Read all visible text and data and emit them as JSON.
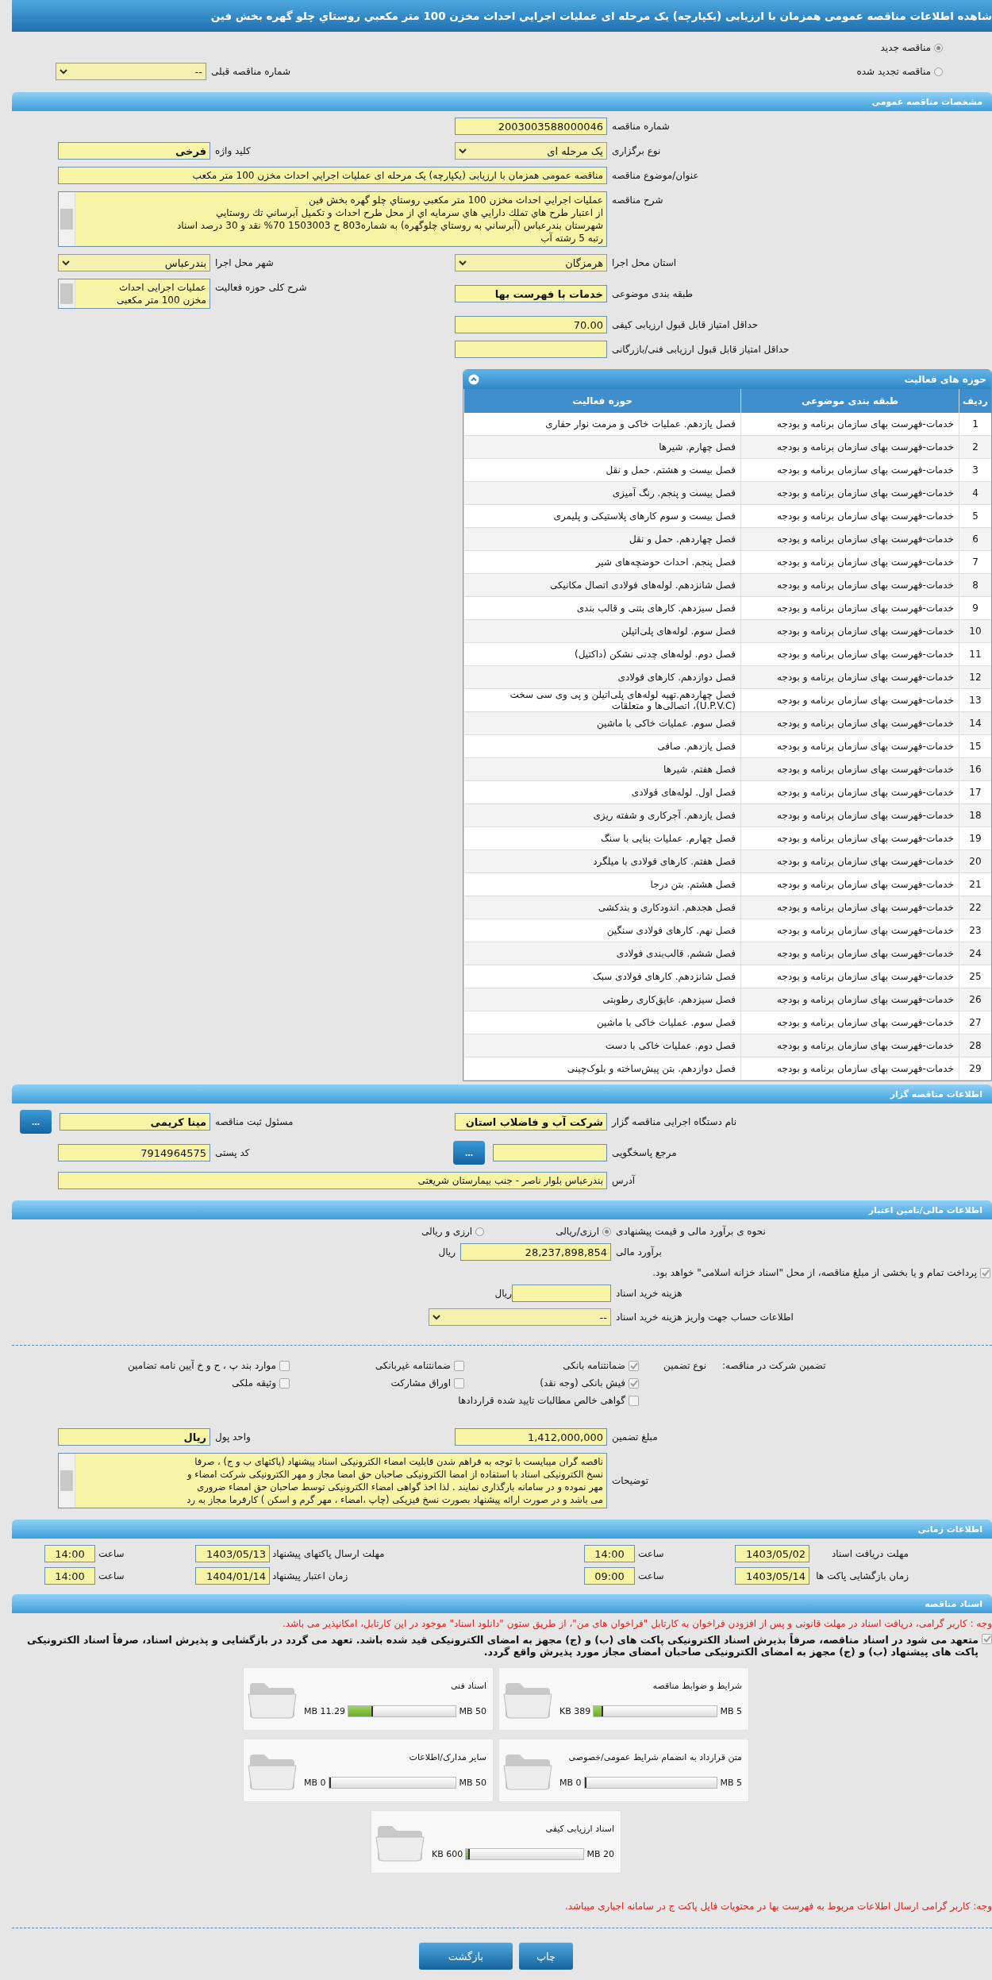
{
  "title": "شاهده اطلاعات مناقصه عمومی همزمان با ارزیابی (یکپارچه) یک مرحله ای عملیات اجرايي احداث مخزن 100 متر مكعبي روستاي چلو گهره بخش فين",
  "tender_type": [
    {
      "label": "مناقصه جدید",
      "selected": true
    },
    {
      "label": "مناقصه تجدید شده",
      "selected": false
    }
  ],
  "previous_tender": {
    "label": "شماره مناقصه قبلی",
    "value": "--"
  },
  "general": {
    "header": "مشخصات مناقصه عمومی",
    "rows": [
      {
        "right": {
          "label": "شماره مناقصه",
          "kind": "text",
          "value": "2003003588000046"
        }
      },
      {
        "right": {
          "label": "نوع برگزاری",
          "kind": "select",
          "value": "یک مرحله ای"
        },
        "left": {
          "label": "کلید واژه",
          "kind": "bold",
          "value": "فرخی"
        }
      },
      {
        "right": {
          "label": "عنوان/موضوع مناقصه",
          "kind": "wide",
          "value": "مناقصه عمومی همزمان با ارزیابی (یکپارچه) یک مرحله ای عملیات اجرايي احداث مخزن 100 متر مکعب"
        }
      },
      {
        "right": {
          "label": "شرح مناقصه",
          "kind": "wide-textarea",
          "lines": [
            "عمليات اجرايي احداث مخزن 100 متر مكعبي روستاي چلو گهره بخش فين",
            "از اعتبار طرح هاي تملك دارايي هاي سرمايه اي از محل طرح احداث و تكميل آبرساني تك روستايي",
            "شهرستان بندرعباس (آبرساني به روستاي چلوگهره) به شماره803 ح 1503003  70% نقد و 30 درصد اسناد",
            "رتبه 5 رشته آب"
          ]
        }
      },
      {
        "right": {
          "label": "استان محل اجرا",
          "kind": "select",
          "value": "هرمزگان"
        },
        "left": {
          "label": "شهر محل اجرا",
          "kind": "select",
          "value": "بندرعباس"
        }
      },
      {
        "right": {
          "label": "طبقه بندی موضوعی",
          "kind": "bold",
          "value": "خدمات با فهرست بها"
        },
        "left": {
          "label": "شرح کلی حوزه فعالیت",
          "kind": "textarea",
          "lines": [
            "عملیات اجرایی احداث",
            "مخزن 100 متر مکعبی"
          ]
        }
      },
      {
        "right": {
          "label": "حداقل امتیاز قابل قبول ارزیابی کیفی",
          "kind": "text",
          "value": "70.00"
        }
      },
      {
        "right": {
          "label": "حداقل امتیاز قابل قبول ارزیابی فنی/بازرگانی",
          "kind": "text"
        }
      }
    ]
  },
  "activities": {
    "header": "حوزه های فعالیت",
    "columns": [
      "ردیف",
      "طبقه بندی موضوعی",
      "حوزه فعالیت"
    ],
    "rows": [
      [
        "1",
        "خدمات-فهرست بهای سازمان برنامه و بودجه",
        "فصل یازدهم. عملیات خاکی و مرمت نوار حفاری"
      ],
      [
        "2",
        "خدمات-فهرست بهای سازمان برنامه و بودجه",
        "فصل چهارم. شیرها"
      ],
      [
        "3",
        "خدمات-فهرست بهای سازمان برنامه و بودجه",
        "فصل بیست و هشتم. حمل و نقل"
      ],
      [
        "4",
        "خدمات-فهرست بهای سازمان برنامه و بودجه",
        "فصل بیست و پنجم. رنگ آمیزی"
      ],
      [
        "5",
        "خدمات-فهرست بهای سازمان برنامه و بودجه",
        "فصل بیست و سوم کارهای پلاستیکی و پلیمری"
      ],
      [
        "6",
        "خدمات-فهرست بهای سازمان برنامه و بودجه",
        "فصل چهاردهم. حمل و نقل"
      ],
      [
        "7",
        "خدمات-فهرست بهای سازمان برنامه و بودجه",
        "فصل پنجم. احداث حوضچه‌های شیر"
      ],
      [
        "8",
        "خدمات-فهرست بهای سازمان برنامه و بودجه",
        "فصل شانزدهم. لوله‌های فولادی اتصال مکانیکی"
      ],
      [
        "9",
        "خدمات-فهرست بهای سازمان برنامه و بودجه",
        "فصل سیزدهم. کارهای بتنی و قالب بندی"
      ],
      [
        "10",
        "خدمات-فهرست بهای سازمان برنامه و بودجه",
        "فصل سوم. لوله‌های پلی‌اتیلن"
      ],
      [
        "11",
        "خدمات-فهرست بهای سازمان برنامه و بودجه",
        "فصل دوم. لوله‌های چدنی نشکن (داکتیل)"
      ],
      [
        "12",
        "خدمات-فهرست بهای سازمان برنامه و بودجه",
        "فصل دوازدهم. کارهای فولادی"
      ],
      [
        "13",
        "خدمات-فهرست بهای سازمان برنامه و بودجه",
        "فصل چهاردهم.تهیه لوله‌های پلی‌اتیلن و پی وی سی سخت (U.P.V.C)، اتصالی‌ها و متعلقات"
      ],
      [
        "14",
        "خدمات-فهرست بهای سازمان برنامه و بودجه",
        "فصل سوم. عملیات خاکی با ماشین"
      ],
      [
        "15",
        "خدمات-فهرست بهای سازمان برنامه و بودجه",
        "فصل یازدهم. صافی"
      ],
      [
        "16",
        "خدمات-فهرست بهای سازمان برنامه و بودجه",
        "فصل هفتم. شیرها"
      ],
      [
        "17",
        "خدمات-فهرست بهای سازمان برنامه و بودجه",
        "فصل اول. لوله‌های فولادی"
      ],
      [
        "18",
        "خدمات-فهرست بهای سازمان برنامه و بودجه",
        "فصل یازدهم. آجرکاری و شفته ریزی"
      ],
      [
        "19",
        "خدمات-فهرست بهای سازمان برنامه و بودجه",
        "فصل چهارم. عملیات بنایی با سنگ"
      ],
      [
        "20",
        "خدمات-فهرست بهای سازمان برنامه و بودجه",
        "فصل هفتم. کارهای فولادی با میلگرد"
      ],
      [
        "21",
        "خدمات-فهرست بهای سازمان برنامه و بودجه",
        "فصل هشتم. بتن درجا"
      ],
      [
        "22",
        "خدمات-فهرست بهای سازمان برنامه و بودجه",
        "فصل هجدهم. اندودکاری و بندکشی"
      ],
      [
        "23",
        "خدمات-فهرست بهای سازمان برنامه و بودجه",
        "فصل نهم. کارهای فولادی سنگین"
      ],
      [
        "24",
        "خدمات-فهرست بهای سازمان برنامه و بودجه",
        "فصل ششم. قالب‌بندی فولادی"
      ],
      [
        "25",
        "خدمات-فهرست بهای سازمان برنامه و بودجه",
        "فصل شانزدهم. کارهای فولادی سبک"
      ],
      [
        "26",
        "خدمات-فهرست بهای سازمان برنامه و بودجه",
        "فصل سیزدهم. عایق‌کاری رطوبتی"
      ],
      [
        "27",
        "خدمات-فهرست بهای سازمان برنامه و بودجه",
        "فصل سوم. عملیات خاکی با ماشین"
      ],
      [
        "28",
        "خدمات-فهرست بهای سازمان برنامه و بودجه",
        "فصل دوم. عملیات خاکی با دست"
      ],
      [
        "29",
        "خدمات-فهرست بهای سازمان برنامه و بودجه",
        "فصل دوازدهم. بتن پیش‌ساخته و بلوک‌چینی"
      ]
    ]
  },
  "organizer": {
    "header": "اطلاعات مناقصه گزار",
    "rows": [
      {
        "right": {
          "label": "نام دستگاه اجرایی مناقصه گزار",
          "kind": "bold",
          "value": "شرکت آب و فاضلاب استان"
        },
        "left": {
          "label": "مسئول ثبت مناقصه",
          "kind": "bold",
          "value": "مینا کریمی",
          "button": "..."
        }
      },
      {
        "right": {
          "label": "مرجع پاسخگویی",
          "kind": "text",
          "button": "..."
        },
        "left": {
          "label": "کد پستی",
          "kind": "text",
          "value": "7914964575"
        }
      },
      {
        "right": {
          "label": "آدرس",
          "kind": "wide-textarea",
          "lines": [
            "بندرعباس بلوار ناصر - جنب بیمارستان شریعتی"
          ]
        }
      }
    ]
  },
  "finance": {
    "header": "اطلاعات مالی/تامین اعتبار",
    "estimate_method": {
      "label": "نحوه ی برآورد مالی و قیمت پیشنهادی",
      "options": [
        {
          "label": "ارزی/ریالی",
          "selected": true
        },
        {
          "label": "ارزی و ریالی",
          "selected": false
        }
      ]
    },
    "estimate": {
      "label": "برآورد مالی",
      "value": "28,237,898,854",
      "unit": "ریال"
    },
    "treasury": {
      "label": "پرداخت تمام و یا بخشی از مبلغ مناقصه، از محل \"اسناد خزانه اسلامی\" خواهد بود.",
      "checked": true
    },
    "document_fee": {
      "label": "هزینه خرید اسناد",
      "unit": "ریال"
    },
    "account": {
      "label": "اطلاعات حساب جهت واریز هزینه خرید اسناد",
      "value": "--"
    },
    "guarantee": {
      "label": "تضمین شرکت در مناقصه:",
      "type_label": "نوع تضمین",
      "options": [
        {
          "label": "ضمانتنامه بانکی",
          "checked": true
        },
        {
          "label": "ضمانتنامه غیربانکی",
          "checked": false
        },
        {
          "label": "موارد بند پ ، ح و خ آیین نامه تضامین",
          "checked": false
        },
        {
          "label": "فیش بانکی (وجه نقد)",
          "checked": true
        },
        {
          "label": "اوراق مشارکت",
          "checked": false
        },
        {
          "label": "وثیقه ملکی",
          "checked": false
        },
        {
          "label": "گواهی خالص مطالبات تایید شده قراردادها",
          "checked": false
        }
      ]
    },
    "guarantee_amount": {
      "label": "مبلغ تضمین",
      "value": "1,412,000,000"
    },
    "currency": {
      "label": "واحد پول",
      "value": "ریال"
    },
    "notes": {
      "label": "توضیحات",
      "lines": [
        "ناقصه گران میبایست با توجه به فراهم شدن قابلیت امضاء الکترونیکی اسناد پیشنهاد (پاکتهای ب و ج) ، صرفا",
        "نسخ الکترونیکی اسناد با استفاده از امضا الکترونیکی صاحبان حق امضا مجاز و مهر الکترونیکی شرکت امضاء و",
        "مهر نموده و در سامانه بارگذاری نمایند . لذا اخذ گواهی امضاء الکترونیکی توسط صاحبان حق امضاء ضروری",
        "می باشد و در صورت ارائه پیشنهاد بصورت نسخ فیزیکی (چاپ ،امضاء ، مهر گرم و اسکن ) کارفرما مجاز به رد"
      ]
    }
  },
  "timing": {
    "header": "اطلاعات زمانی",
    "rows": [
      [
        {
          "label": "مهلت دریافت اسناد",
          "date": "1403/05/02",
          "time_label": "ساعت",
          "time": "14:00"
        },
        {
          "label": "مهلت ارسال پاکتهای پیشنهاد",
          "date": "1403/05/13",
          "time_label": "ساعت",
          "time": "14:00"
        }
      ],
      [
        {
          "label": "زمان بازگشایی پاکت ها",
          "date": "1403/05/14",
          "time_label": "ساعت",
          "time": "09:00"
        },
        {
          "label": "زمان اعتبار پیشنهاد",
          "date": "1404/01/14",
          "time_label": "ساعت",
          "time": "14:00"
        }
      ]
    ]
  },
  "documents": {
    "header": "اسناد مناقصه",
    "notice": "وجه : کاربر گرامی، دریافت اسناد در مهلت قانونی و پس از افزودن فراخوان به کارتابل \"فراخوان های من\"، از طریق ستون \"دانلود اسناد\" موجود در این کارتابل، امکانپذیر می باشد.",
    "commitment": {
      "label": "متعهد می شود در اسناد مناقصه، صرفاً بذیرش اسناد الکترونیکی پاکت های (ب) و (ج) مجهز به امضای الکترونیکی قید شده باشد. تعهد می گردد در بازگشایی و پذیرش اسناد، صرفاً اسناد الکترونیکی پاکت های پیشنهاد (ب) و (ج) مجهز به امضای الکترونیکی صاحبان امضای مجاز مورد پذیرش واقع گردد.",
      "checked": true
    },
    "files": [
      {
        "name": "شرایط و ضوابط مناقصه",
        "max": "5 MB",
        "used": "389 KB",
        "level": 0.076
      },
      {
        "name": "اسناد فنی",
        "max": "50 MB",
        "used": "11.29 MB",
        "level": 0.226
      },
      {
        "name": "متن قرارداد به انضمام شرایط عمومی/خصوصی",
        "max": "5 MB",
        "used": "0 MB",
        "level": 0
      },
      {
        "name": "سایر مدارک/اطلاعات",
        "max": "50 MB",
        "used": "0 MB",
        "level": 0
      },
      {
        "name": "اسناد ارزیابی کیفی",
        "max": "20 MB",
        "used": "600 KB",
        "level": 0.03
      }
    ],
    "footer_notice": "وجه: کاربر گرامی ارسال اطلاعات مربوط به فهرست بها در محتویات فایل پاکت ج در سامانه اجباری میباشد."
  },
  "buttons": [
    "چاپ",
    "بازگشت"
  ]
}
